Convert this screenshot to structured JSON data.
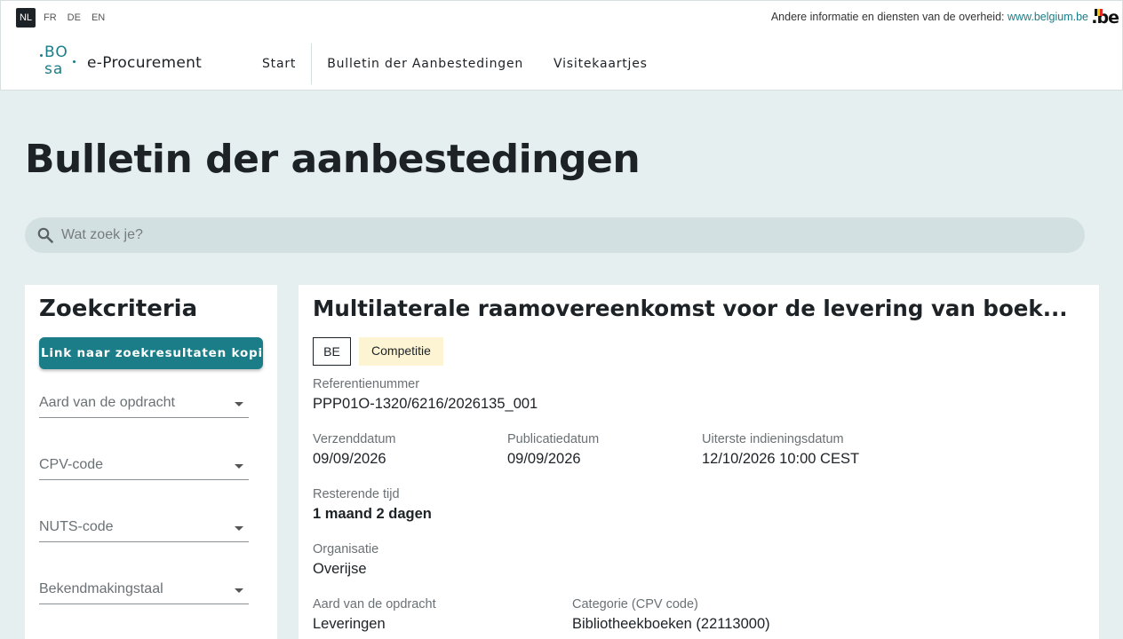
{
  "languages": [
    {
      "code": "NL",
      "active": true
    },
    {
      "code": "FR",
      "active": false
    },
    {
      "code": "DE",
      "active": false
    },
    {
      "code": "EN",
      "active": false
    }
  ],
  "gov_info": {
    "text": "Andere informatie en diensten van de overheid: ",
    "link": "www.belgium.be",
    "logo": ".be"
  },
  "brand": {
    "logo_top": "BO",
    "logo_bottom": "sa",
    "name": "e-Procurement"
  },
  "nav": [
    "Start",
    "Bulletin der Aanbestedingen",
    "Visitekaartjes"
  ],
  "page_title": "Bulletin der aanbestedingen",
  "search": {
    "placeholder": "Wat zoek je?",
    "value": "",
    "icon": "search-icon"
  },
  "sidebar": {
    "title": "Zoekcriteria",
    "copy_button": "Link naar zoekresultaten kopiëren",
    "filters": [
      "Aard van de opdracht",
      "CPV-code",
      "NUTS-code",
      "Bekendmakingstaal"
    ]
  },
  "notice": {
    "title": "Multilaterale raamovereenkomst voor de levering van boek...",
    "tags": {
      "country": "BE",
      "status": "Competitie"
    },
    "reference": {
      "label": "Referentienummer",
      "value": "PPP01O-1320/6216/2026135_001"
    },
    "sent": {
      "label": "Verzenddatum",
      "value": "09/09/2026"
    },
    "published": {
      "label": "Publicatiedatum",
      "value": "09/09/2026"
    },
    "deadline": {
      "label": "Uiterste indieningsdatum",
      "value": "12/10/2026 10:00 CEST"
    },
    "remaining": {
      "label": "Resterende tijd",
      "value": "1 maand 2 dagen"
    },
    "organisation": {
      "label": "Organisatie",
      "value": "Overijse"
    },
    "contract_type": {
      "label": "Aard van de opdracht",
      "value": "Leveringen"
    },
    "category": {
      "label": "Categorie (CPV code)",
      "value": "Bibliotheekboeken (22113000)"
    }
  },
  "colors": {
    "accent": "#1a7d87",
    "background": "#e6eff0",
    "status_tag": "#fdf4d4"
  }
}
